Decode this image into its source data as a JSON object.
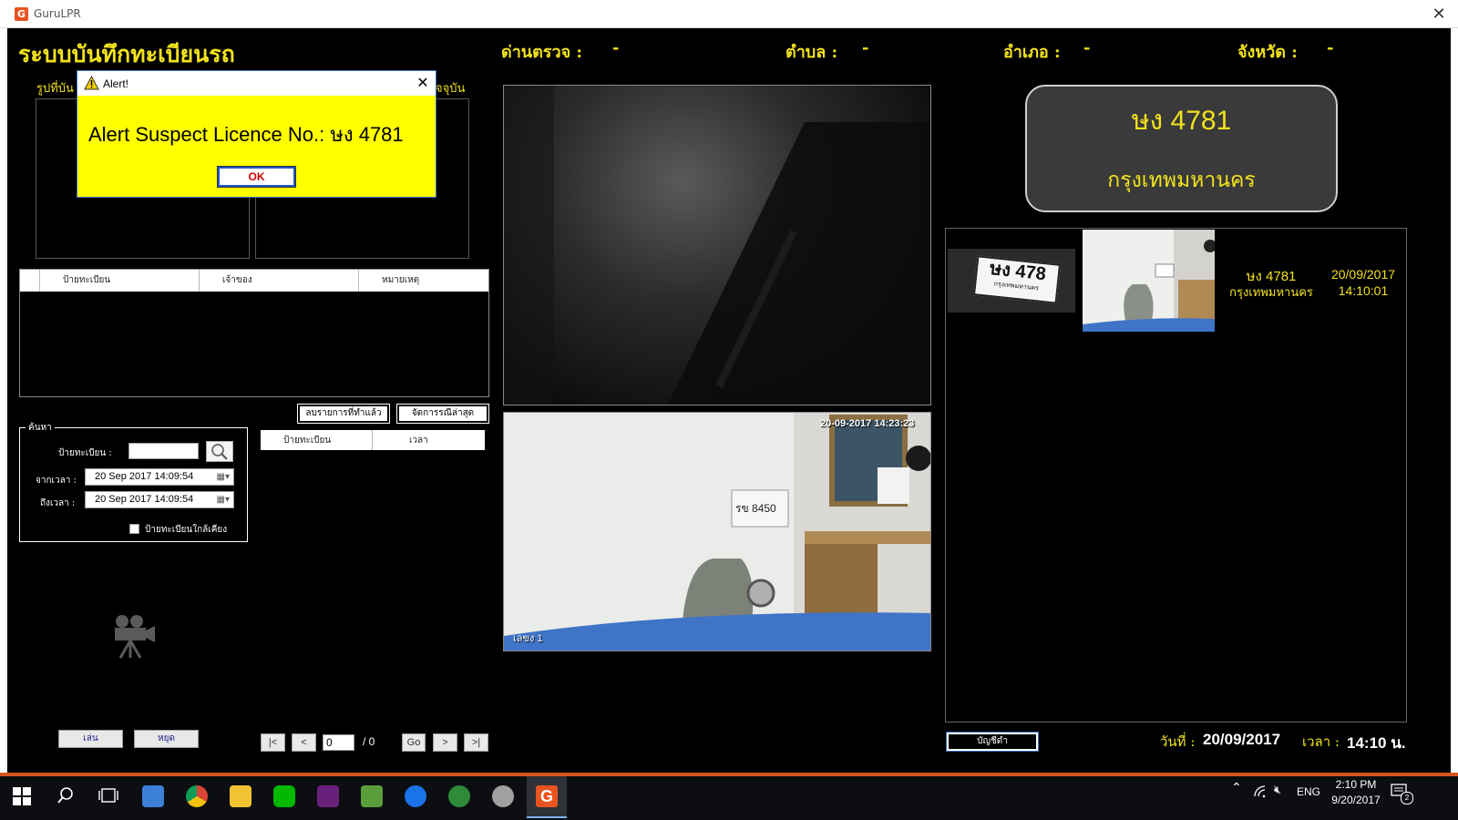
{
  "window": {
    "title": "GuruLPR",
    "logo_letter": "G"
  },
  "header": {
    "title": "ระบบบันทึกทะเบียนรถ",
    "checkpoint_label": "ด่านตรวจ :",
    "checkpoint_value": "-",
    "subdistrict_label": "ตำบล :",
    "subdistrict_value": "-",
    "district_label": "อำเภอ :",
    "district_value": "-",
    "province_label": "จังหวัด :",
    "province_value": "-"
  },
  "left": {
    "saved_image_label": "รูปที่บัน",
    "current_image_label": "จจุบัน",
    "table_headers": [
      "ป้ายทะเบียน",
      "เจ้าของ",
      "หมายเหตุ"
    ],
    "delete_done_button": "ลบรายการที่ทำแล้ว",
    "manage_latest_button": "จัดการรณีล่าสุด",
    "results_headers": [
      "ป้ายทะเบียน",
      "เวลา"
    ],
    "search": {
      "legend": "ค้นหา",
      "plate_label": "ป้ายทะเบียน :",
      "plate_value": "",
      "from_label": "จากเวลา :",
      "from_value": "20 Sep 2017   14:09:54",
      "to_label": "ถึงเวลา :",
      "to_value": "20 Sep 2017   14:09:54",
      "nearby_label": "ป้ายทะเบียนใกล้เคียง",
      "nearby_checked": false
    },
    "play_button": "เล่น",
    "stop_button": "หยุด",
    "pager": {
      "first": "|<",
      "prev": "<",
      "page_value": "0",
      "total": "/ 0",
      "go": "Go",
      "next": ">",
      "last": ">|"
    }
  },
  "cameras": {
    "cam2_timestamp": "20-09-2017 14:23:23",
    "cam2_label": "เลขง 1",
    "cam2_sign_plate": "รข 8450"
  },
  "plate_display": {
    "plate": "ษง 4781",
    "province": "กรุงเทพมหานคร"
  },
  "results": [
    {
      "crop_text": "ษง 478",
      "crop_province": "กรุงเทพมหานคร",
      "plate": "ษง 4781",
      "province": "กรุงเทพมหานคร",
      "date": "20/09/2017",
      "time": "14:10:01"
    }
  ],
  "footer": {
    "blacklist_button": "บัญชีดำ",
    "date_label": "วันที่ :",
    "date_value": "20/09/2017",
    "time_label": "เวลา :",
    "time_value": "14:10 น."
  },
  "alert": {
    "title": "Alert!",
    "message": "Alert Suspect Licence No.: ษง 4781",
    "ok_label": "OK"
  },
  "taskbar": {
    "language": "ENG",
    "clock_time": "2:10 PM",
    "clock_date": "9/20/2017",
    "notification_count": "2"
  },
  "colors": {
    "accent_yellow": "#f2e21b",
    "alert_bg": "#ffff00",
    "taskbar_accent": "#d5561d"
  }
}
